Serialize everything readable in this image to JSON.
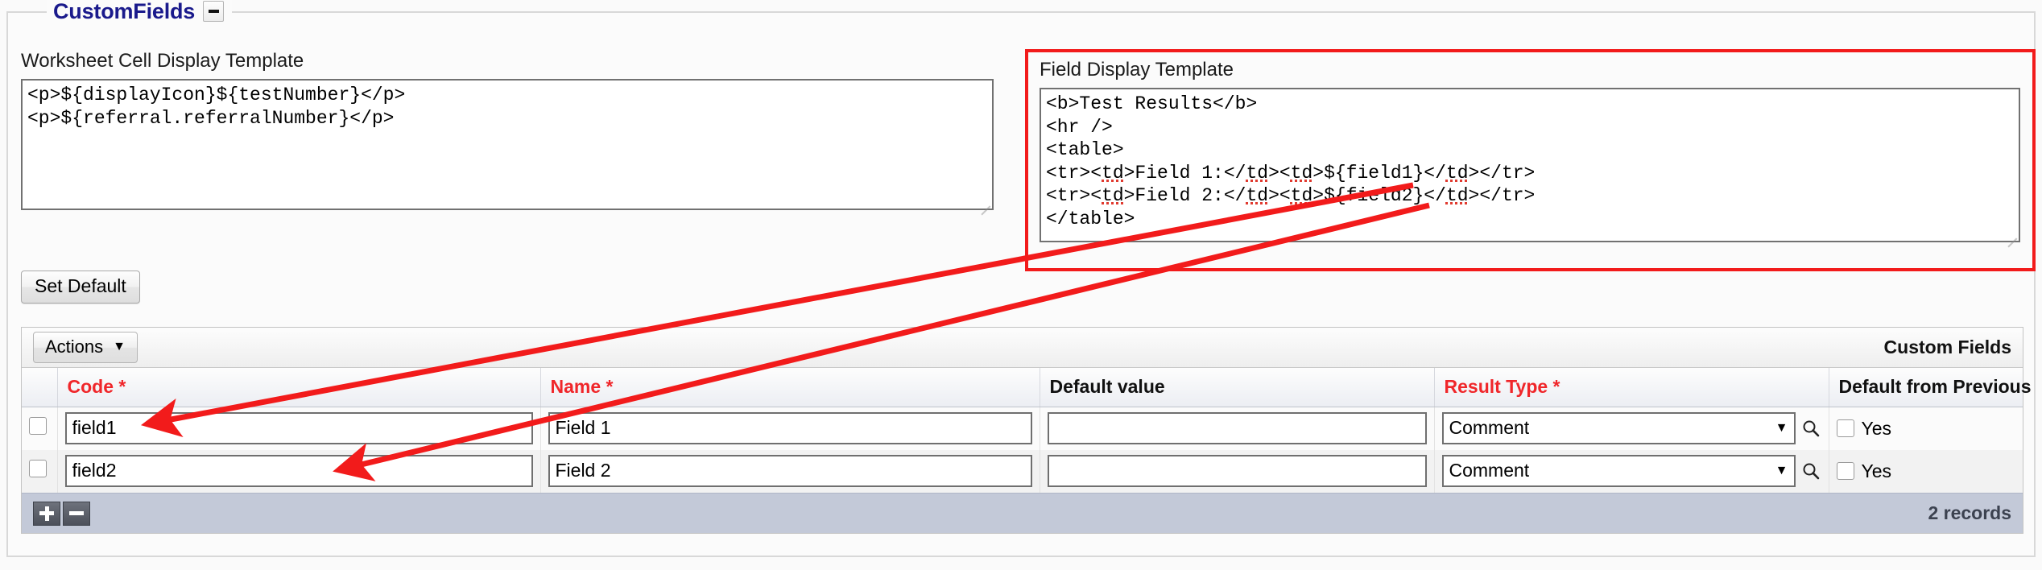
{
  "panel": {
    "legend": "CustomFields",
    "collapse_icon": "minus-icon"
  },
  "templates": {
    "worksheet": {
      "label": "Worksheet Cell Display Template",
      "value": "<p>${displayIcon}${testNumber}</p>\n<p>${referral.referralNumber}</p>"
    },
    "field": {
      "label": "Field Display Template",
      "line1_a": "<b>Test Results</b>",
      "line2_a": "<hr />",
      "line3_a": "<table>",
      "line4": {
        "p1": "<tr><",
        "s1": "td",
        "p2": ">Field 1:</",
        "s2": "td",
        "p3": "><",
        "s3": "td",
        "p4": ">${field1}</",
        "s4": "td",
        "p5": "></tr>"
      },
      "line5": {
        "p1": "<tr><",
        "s1": "td",
        "p2": ">Field 2:</",
        "s2": "td",
        "p3": "><",
        "s3": "td",
        "p4": ">${field2}</",
        "s4": "td",
        "p5": "></tr>"
      },
      "line6_a": "</table>",
      "highlight_color": "#f21b1b"
    }
  },
  "buttons": {
    "set_default": "Set Default",
    "actions": "Actions",
    "actions_caret": "▼"
  },
  "grid": {
    "title": "Custom Fields",
    "columns": [
      {
        "label": "Code *",
        "required": true
      },
      {
        "label": "Name *",
        "required": true
      },
      {
        "label": "Default value",
        "required": false
      },
      {
        "label": "Result Type *",
        "required": true
      },
      {
        "label": "Default from Previous",
        "required": false
      }
    ],
    "rows": [
      {
        "checked": false,
        "code": "field1",
        "name": "Field 1",
        "default_value": "",
        "result_type": "Comment",
        "default_from_previous_label": "Yes",
        "default_from_previous_checked": false
      },
      {
        "checked": false,
        "code": "field2",
        "name": "Field 2",
        "default_value": "",
        "result_type": "Comment",
        "default_from_previous_label": "Yes",
        "default_from_previous_checked": false
      }
    ],
    "footer": {
      "add_icon": "plus-icon",
      "remove_icon": "minus-icon",
      "records": "2 records"
    },
    "select_caret": "▼",
    "search_icon": "magnifier-icon"
  }
}
